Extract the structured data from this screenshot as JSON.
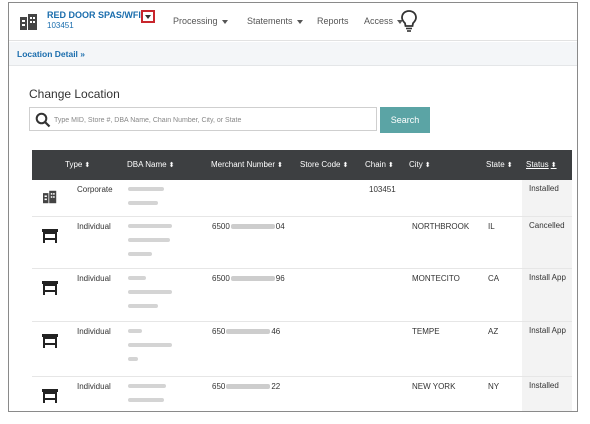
{
  "header": {
    "brand_name": "RED DOOR SPAS/WFI",
    "brand_id": "103451",
    "nav": [
      {
        "label": "Processing",
        "has_caret": true
      },
      {
        "label": "Statements",
        "has_caret": true
      },
      {
        "label": "Reports",
        "has_caret": false
      },
      {
        "label": "Access",
        "has_caret": true
      }
    ],
    "icons": {
      "logo": "building-icon",
      "dropdown": "caret-down-icon",
      "help": "lightbulb-icon"
    }
  },
  "breadcrumb": {
    "label": "Location Detail »"
  },
  "main": {
    "title": "Change Location",
    "search": {
      "placeholder": "Type MID, Store #, DBA Name, Chain Number, City, or State",
      "value": "",
      "button_label": "Search"
    }
  },
  "table": {
    "columns": [
      {
        "label": "Type",
        "sort": "⬍"
      },
      {
        "label": "DBA Name",
        "sort": "⬍"
      },
      {
        "label": "Merchant Number",
        "sort": "⬍"
      },
      {
        "label": "Store Code",
        "sort": "⬍"
      },
      {
        "label": "Chain",
        "sort": "⬍"
      },
      {
        "label": "City",
        "sort": "⬍"
      },
      {
        "label": "State",
        "sort": "⬍"
      },
      {
        "label": "Status",
        "sort": "⬍"
      }
    ],
    "rows": [
      {
        "icon": "building-icon",
        "type": "Corporate",
        "dba_lines": 2,
        "mn_prefix": "",
        "mn_suffix": "",
        "store_code": "",
        "chain": "103451",
        "city": "",
        "state": "",
        "status": "Installed"
      },
      {
        "icon": "storefront-icon",
        "type": "Individual",
        "dba_lines": 3,
        "mn_prefix": "6500",
        "mn_suffix": "04",
        "store_code": "",
        "chain": "",
        "city": "NORTHBROOK",
        "state": "IL",
        "status": "Cancelled"
      },
      {
        "icon": "storefront-icon",
        "type": "Individual",
        "dba_lines": 3,
        "mn_prefix": "6500",
        "mn_suffix": "96",
        "store_code": "",
        "chain": "",
        "city": "MONTECITO",
        "state": "CA",
        "status": "Install App"
      },
      {
        "icon": "storefront-icon",
        "type": "Individual",
        "dba_lines": 3,
        "mn_prefix": "650",
        "mn_suffix": "46",
        "store_code": "",
        "chain": "",
        "city": "TEMPE",
        "state": "AZ",
        "status": "Install App"
      },
      {
        "icon": "storefront-icon",
        "type": "Individual",
        "dba_lines": 2,
        "mn_prefix": "650",
        "mn_suffix": "22",
        "store_code": "",
        "chain": "",
        "city": "NEW YORK",
        "state": "NY",
        "status": "Installed"
      }
    ]
  },
  "colors": {
    "brand": "#1a6dad",
    "table_header": "#3d3f41",
    "search_button": "#5ba4a5",
    "highlight_box": "#c8262d"
  }
}
